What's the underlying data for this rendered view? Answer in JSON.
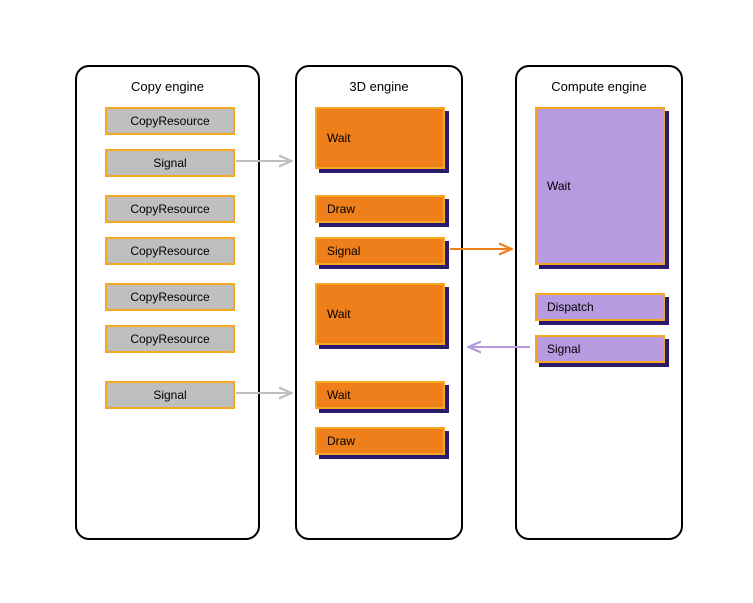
{
  "copyEngine": {
    "title": "Copy engine",
    "blocks": [
      {
        "label": "CopyResource"
      },
      {
        "label": "Signal"
      },
      {
        "label": "CopyResource"
      },
      {
        "label": "CopyResource"
      },
      {
        "label": "CopyResource"
      },
      {
        "label": "CopyResource"
      },
      {
        "label": "Signal"
      }
    ]
  },
  "d3Engine": {
    "title": "3D engine",
    "blocks": [
      {
        "label": "Wait"
      },
      {
        "label": "Draw"
      },
      {
        "label": "Signal"
      },
      {
        "label": "Wait"
      },
      {
        "label": "Wait"
      },
      {
        "label": "Draw"
      }
    ]
  },
  "computeEngine": {
    "title": "Compute engine",
    "blocks": [
      {
        "label": "Wait"
      },
      {
        "label": "Dispatch"
      },
      {
        "label": "Signal"
      }
    ]
  }
}
